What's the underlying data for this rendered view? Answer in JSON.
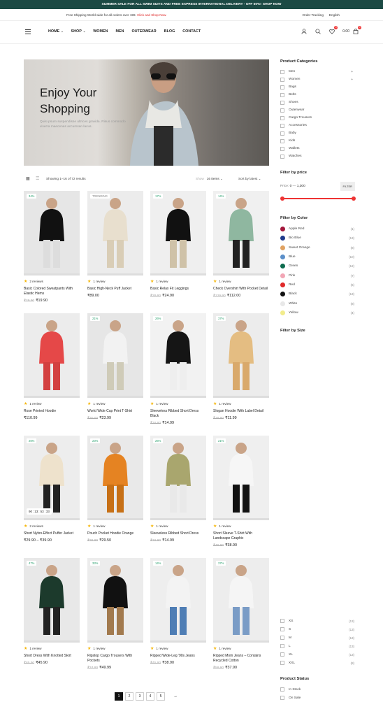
{
  "topbar": {
    "text": "SUMMER SALE FOR ALL SWIM SUITS AND FREE EXPRESS INTERNATIONAL DELIVERY - OFF 50%!",
    "cta": "SHOP NOW"
  },
  "subbar": {
    "message": "Free Shipping World wide for all orders over",
    "amount": "199.",
    "link": "Click and Shop Now.",
    "tracking": "Order Tracking",
    "language": "English"
  },
  "nav": {
    "items": [
      "HOME",
      "SHOP",
      "WOMEN",
      "MEN",
      "OUTERWEAR",
      "BLOG",
      "CONTACT"
    ]
  },
  "header": {
    "cart_total": "0.00",
    "wishlist_count": "0",
    "cart_count": "0"
  },
  "hero": {
    "title_line1": "Enjoy Your",
    "title_line2": "Shopping",
    "text": "Quis ipsum suspendisse ultrices gravida. Risus commodo viverra maecenas accumsan lacus."
  },
  "toolbar": {
    "count": "Showing 1–16 of 72 results",
    "show_label": "Show",
    "show_value": "16 Items",
    "sort_value": "Sort by latest"
  },
  "products": [
    {
      "tag": "34%",
      "reviews": "2 reviews",
      "name": "Basic Colored Sweatpants With Elastic Hems",
      "old": "₹29.90",
      "price": "₹19.90"
    },
    {
      "tag": "TRENDING",
      "reviews": "1 review",
      "name": "Basic High-Neck Puff Jacket",
      "old": "",
      "price": "₹89.00"
    },
    {
      "tag": "17%",
      "reviews": "1 review",
      "name": "Basic Relax Fit Leggings",
      "old": "₹29.90",
      "price": "₹24.90"
    },
    {
      "tag": "14%",
      "reviews": "1 review",
      "name": "Check Overshirt With Pocket Detail",
      "old": "₹129.90",
      "price": "₹112.00"
    },
    {
      "tag": "",
      "reviews": "1 review",
      "name": "Rose Printed Hoodie",
      "old": "",
      "price": "₹110.99"
    },
    {
      "tag": "21%",
      "reviews": "1 review",
      "name": "World Wide Cup Print T-Shirt",
      "old": "₹30.00",
      "price": "₹23.99"
    },
    {
      "tag": "26%",
      "reviews": "1 review",
      "name": "Sleeveless Ribbed Short Dress Black",
      "old": "₹19.90",
      "price": "₹14.99"
    },
    {
      "tag": "37%",
      "reviews": "1 review",
      "name": "Slogan Hoodie With Label Detail",
      "old": "₹18.90",
      "price": "₹11.99"
    },
    {
      "tag": "26%",
      "reviews": "2 reviews",
      "name": "Short Nylon-Effect Puffer Jacket",
      "old": "",
      "price": "₹29.90 – ₹39.90",
      "countdown": [
        "90",
        "13",
        "53",
        "33"
      ]
    },
    {
      "tag": "23%",
      "reviews": "1 review",
      "name": "Pouch Pocket Hoodie Orange",
      "old": "₹38.90",
      "price": "₹29.50"
    },
    {
      "tag": "26%",
      "reviews": "1 review",
      "name": "Sleeveless Ribbed Short Dress",
      "old": "₹19.90",
      "price": "₹14.99"
    },
    {
      "tag": "21%",
      "reviews": "1 review",
      "name": "Short Sleeve T-Shirt With Landscape Graphic",
      "old": "₹49.90",
      "price": "₹38.90"
    },
    {
      "tag": "47%",
      "reviews": "1 review",
      "name": "Short Dress With Knotted Skirt",
      "old": "₹85.90",
      "price": "₹45.90"
    },
    {
      "tag": "33%",
      "reviews": "1 review",
      "name": "Ripstop Cargo Trousers With Pockets",
      "old": "₹74.90",
      "price": "₹49.99"
    },
    {
      "tag": "14%",
      "reviews": "1 review",
      "name": "Ripped Wide-Leg '90s Jeans",
      "old": "₹45.90",
      "price": "₹38.90"
    },
    {
      "tag": "37%",
      "reviews": "1 review",
      "name": "Ripped Mom Jeans – Contains Recycled Cotton",
      "old": "₹59.90",
      "price": "₹37.90"
    }
  ],
  "sidebar": {
    "categories_title": "Product Categories",
    "categories": [
      "Men",
      "Women",
      "Bags",
      "Belts",
      "Shoes",
      "Outerwear",
      "Cargo Trousers",
      "Accessories",
      "Baby",
      "Kids",
      "Wallets",
      "Watches"
    ],
    "price_title": "Filter by price",
    "price_label": "Price:",
    "price_min": "0",
    "price_max": "1,300",
    "filter_button": "FILTER",
    "color_title": "Filter by Color",
    "colors": [
      {
        "name": "Apple Red",
        "count": "(1)",
        "hex": "#a3173b"
      },
      {
        "name": "Bio Blue",
        "count": "(13)",
        "hex": "#1f3b8c"
      },
      {
        "name": "Sweet Orange",
        "count": "(8)",
        "hex": "#e0a262"
      },
      {
        "name": "Blue",
        "count": "(10)",
        "hex": "#5b8fc9"
      },
      {
        "name": "Green",
        "count": "(12)",
        "hex": "#0d6b4e"
      },
      {
        "name": "Pink",
        "count": "(7)",
        "hex": "#f2a6b5"
      },
      {
        "name": "Red",
        "count": "(6)",
        "hex": "#e02a2a"
      },
      {
        "name": "Black",
        "count": "(13)",
        "hex": "#111111"
      },
      {
        "name": "White",
        "count": "(8)",
        "hex": "#e8e8e8"
      },
      {
        "name": "Yellow",
        "count": "(4)",
        "hex": "#f2ec8c"
      }
    ],
    "size_title": "Filter by Size",
    "sizes": [
      {
        "name": "XS",
        "count": "(13)"
      },
      {
        "name": "S",
        "count": "(13)"
      },
      {
        "name": "M",
        "count": "(13)"
      },
      {
        "name": "L",
        "count": "(13)"
      },
      {
        "name": "XL",
        "count": "(13)"
      },
      {
        "name": "XXL",
        "count": "(8)"
      }
    ],
    "status_title": "Product Status",
    "statuses": [
      "In Stock",
      "On Sale"
    ]
  },
  "pagination": {
    "pages": [
      "1",
      "2",
      "3",
      "4",
      "5"
    ],
    "next": "→"
  }
}
